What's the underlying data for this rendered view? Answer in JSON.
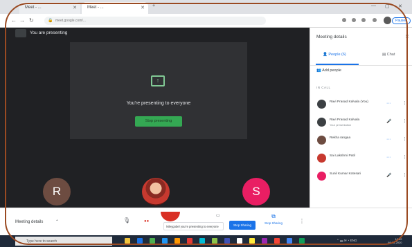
{
  "browser": {
    "tabs": [
      {
        "label": "Meet - ...",
        "active": false
      },
      {
        "label": "Meet - ...",
        "active": true
      }
    ],
    "url": "meet.google.com/...",
    "profile_badge": "Paused"
  },
  "stage": {
    "presenting_label": "You are presenting",
    "banner_title": "You're presenting to everyone",
    "stop_presenting_label": "Stop presenting",
    "tiles": [
      {
        "initial": "R",
        "color": "#6d4c41"
      },
      {
        "initial": "",
        "color": "#c7392f"
      },
      {
        "initial": "S",
        "color": "#e91e63"
      }
    ]
  },
  "panel": {
    "title": "Meeting details",
    "tabs": [
      {
        "label": "People (6)",
        "icon": "people-icon",
        "active": true
      },
      {
        "label": "Chat",
        "icon": "chat-icon",
        "active": false
      }
    ],
    "add_people": "Add people",
    "section_label": "IN CALL",
    "participants": [
      {
        "name": "Ravi Prasad Kalvala (You)",
        "sub": "",
        "color": "#3c4043",
        "mic": "active"
      },
      {
        "name": "Ravi Prasad Kalvala",
        "sub": "Your presentation",
        "color": "#3c4043",
        "mic": "muted"
      },
      {
        "name": "Rekha rangaa",
        "sub": "",
        "color": "#6d4c41",
        "mic": "active"
      },
      {
        "name": "Sai Lakshmi Patil",
        "sub": "",
        "color": "#c7392f",
        "mic": "active"
      },
      {
        "name": "Sunil Kumar Kotesari",
        "sub": "",
        "color": "#e91e63",
        "mic": "muted"
      }
    ]
  },
  "bottombar": {
    "meeting_details": "Meeting details",
    "toast_text": "Nileygobel you're presenting to everyone",
    "stop_presenting_button": "Stop Sharing",
    "present_now_label": "Stop Sharing"
  },
  "taskbar": {
    "search_placeholder": "Type here to search",
    "clock_time": "18:32",
    "clock_date": "08-05-2020",
    "colors": [
      "#f0c33c",
      "#1a73e8",
      "#4caf50",
      "#2196f3",
      "#ff9800",
      "#e53935",
      "#00bcd4",
      "#8bc34a",
      "#3f51b5",
      "#ffffff",
      "#ffeb3b",
      "#9c27b0",
      "#f44336",
      "#4285f4",
      "#0f9d58"
    ]
  }
}
